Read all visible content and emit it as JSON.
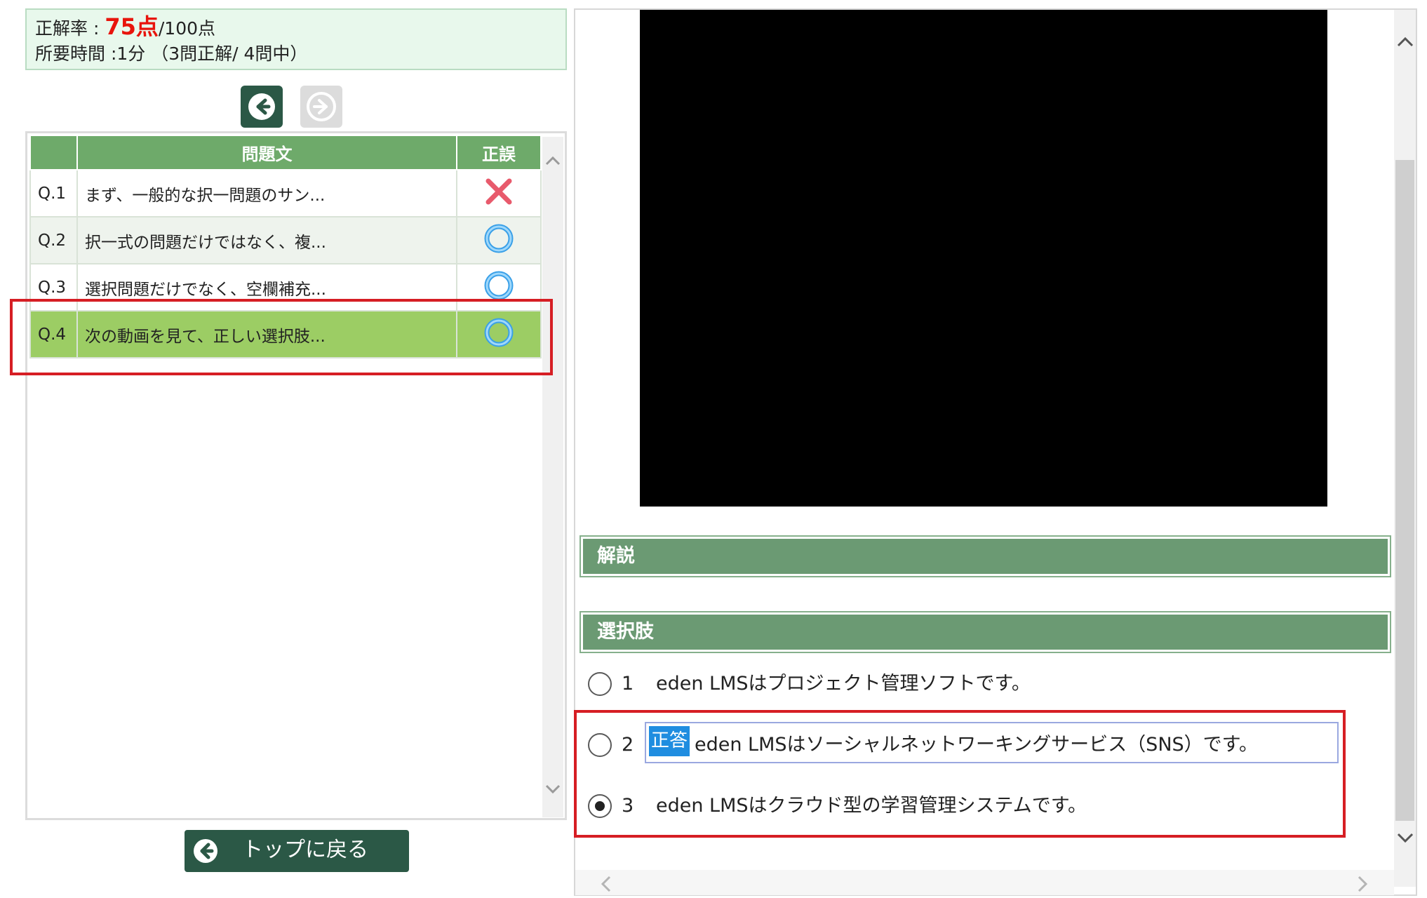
{
  "score": {
    "label": "正解率 : ",
    "value": "75点",
    "max": "/100点",
    "time_line": "所要時間 :1分 （3問正解/ 4問中）"
  },
  "nav": {
    "prev_icon": "arrow-left-icon",
    "next_icon": "arrow-right-icon"
  },
  "table": {
    "headers": [
      "",
      "問題文",
      "正誤"
    ],
    "rows": [
      {
        "num": "Q.1",
        "text": "まず、一般的な択一問題のサン...",
        "result": "incorrect"
      },
      {
        "num": "Q.2",
        "text": "択一式の問題だけではなく、複...",
        "result": "correct"
      },
      {
        "num": "Q.3",
        "text": "選択問題だけでなく、空欄補充...",
        "result": "correct"
      },
      {
        "num": "Q.4",
        "text": "次の動画を見て、正しい選択肢...",
        "result": "correct"
      }
    ]
  },
  "back_button": {
    "label": "トップに戻る"
  },
  "detail": {
    "explanation_title": "解説",
    "choices_title": "選択肢",
    "correct_tag": "正答",
    "choices": [
      {
        "num": "1",
        "text": "eden LMSはプロジェクト管理ソフトです。",
        "selected": false
      },
      {
        "num": "2",
        "text": "eden LMSはソーシャルネットワーキングサービス（SNS）です。",
        "selected": false
      },
      {
        "num": "3",
        "text": "eden LMSはクラウド型の学習管理システムです。",
        "selected": true
      }
    ]
  },
  "colors": {
    "accent_green": "#6eaa6a",
    "active_row": "#9ccd64",
    "dark_green": "#2b5846",
    "score_red": "#e8140c",
    "highlight_red": "#d61e24",
    "correct_blue": "#1f8de0"
  }
}
